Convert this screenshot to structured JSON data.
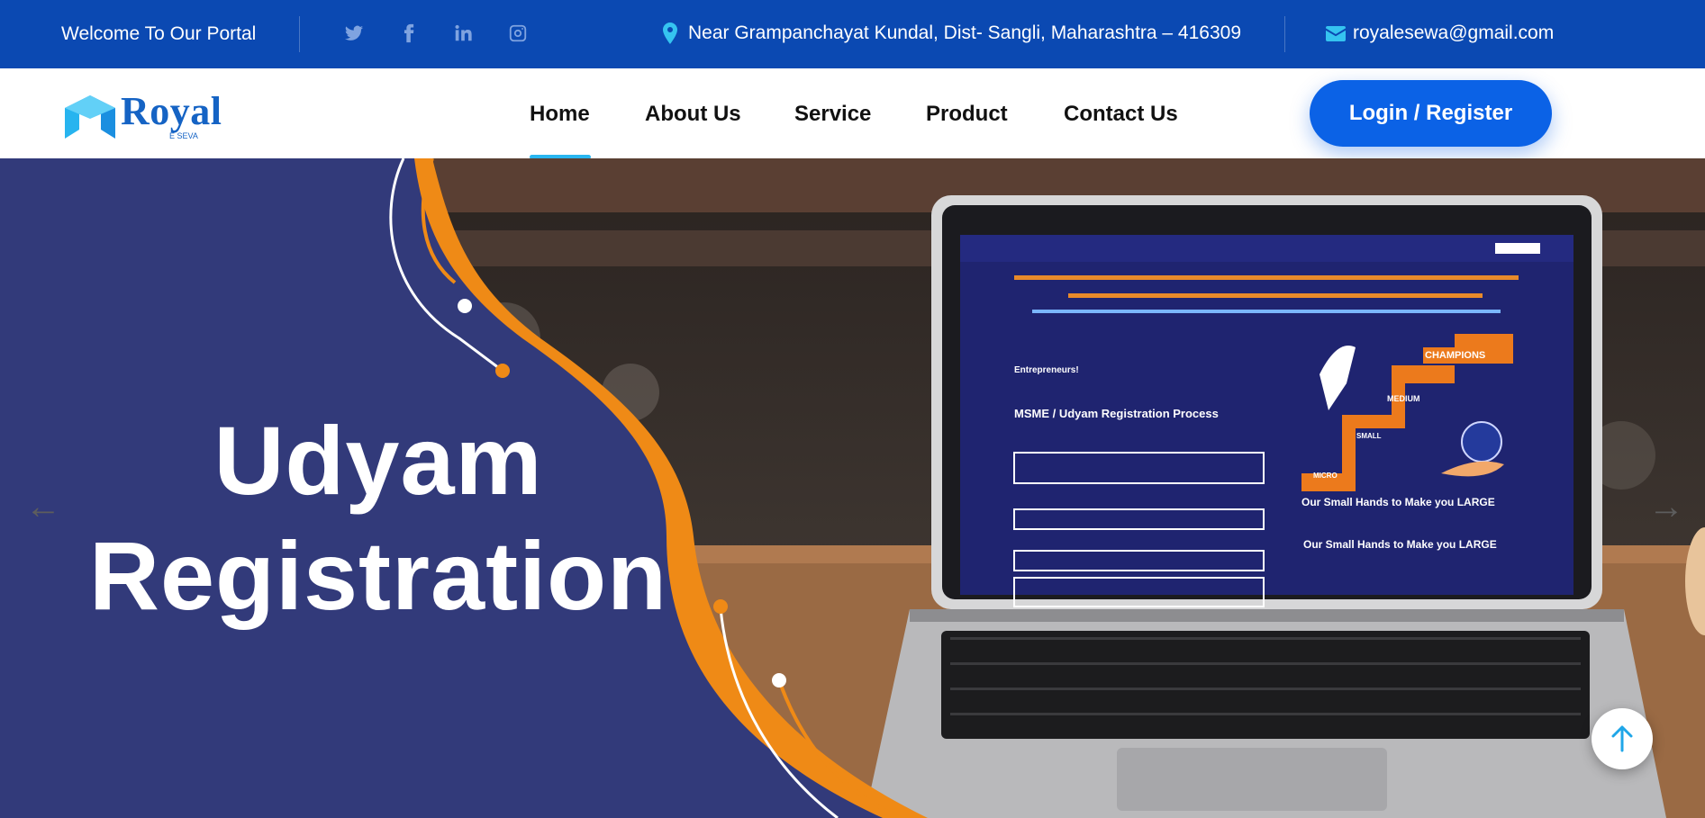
{
  "topbar": {
    "welcome": "Welcome To Our Portal",
    "social_icons": [
      "twitter-icon",
      "facebook-icon",
      "linkedin-icon",
      "instagram-icon"
    ],
    "address": "Near Grampanchayat Kundal, Dist- Sangli, Maharashtra – 416309",
    "email": "royalesewa@gmail.com"
  },
  "logo": {
    "name": "Royal",
    "tagline": "E SEVA"
  },
  "nav": {
    "items": [
      {
        "label": "Home",
        "active": true
      },
      {
        "label": "About Us"
      },
      {
        "label": "Service"
      },
      {
        "label": "Product"
      },
      {
        "label": "Contact Us"
      }
    ],
    "login_label": "Login / Register"
  },
  "hero": {
    "title_line1": "Udyam",
    "title_line2": "Registration",
    "prev_arrow": "←",
    "next_arrow": "→",
    "screen": {
      "process_title": "MSME / Udyam Registration Process",
      "entrepreneurs": "Entrepreneurs!",
      "steps": [
        "CHAMPIONS",
        "MEDIUM",
        "SMALL",
        "MICRO"
      ],
      "tagline": "Our Small Hands to Make you LARGE",
      "tagline2": "Our Small Hands to Make you LARGE"
    }
  },
  "colors": {
    "topbar": "#0b49b2",
    "hero_navy": "#323a7a",
    "accent_orange": "#ef8a16",
    "button_blue": "#0b62e6",
    "underline": "#29b6f0"
  }
}
